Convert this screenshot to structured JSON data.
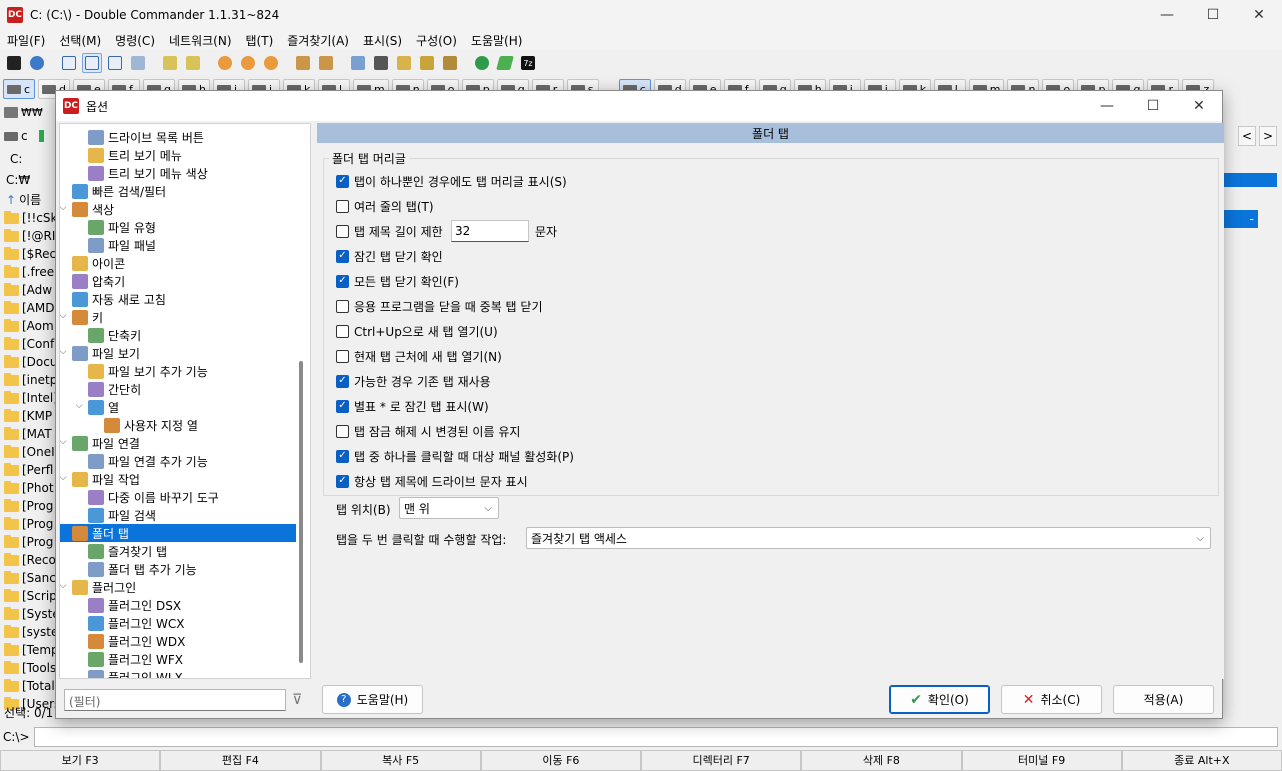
{
  "window": {
    "title": "C: (C:\\) - Double Commander 1.1.31~824",
    "minimize": "—",
    "maximize": "☐",
    "close": "✕"
  },
  "menu": [
    "파일(F)",
    "선택(M)",
    "명령(C)",
    "네트워크(N)",
    "탭(T)",
    "즐겨찾기(A)",
    "표시(S)",
    "구성(O)",
    "도움말(H)"
  ],
  "drives_left": [
    "c",
    "d",
    "e",
    "f",
    "g",
    "h",
    "i",
    "j",
    "k",
    "l",
    "m",
    "n",
    "o",
    "p",
    "q",
    "r",
    "s"
  ],
  "drives_right": [
    "c",
    "d",
    "e",
    "f",
    "g",
    "h",
    "i",
    "j",
    "k",
    "l",
    "m",
    "n",
    "o",
    "p",
    "q",
    "r",
    "z"
  ],
  "left_panel": {
    "tab_label": "₩₩",
    "drive": "c",
    "path_drive": "C:",
    "path": "C:₩",
    "column_name": "이름",
    "files": [
      "[!!cSk",
      "[!@RI",
      "[$Rec",
      "[.free",
      "[Adw",
      "[AMD",
      "[Aom",
      "[Conf",
      "[Docu",
      "[inetp",
      "[Intel]",
      "[KMP",
      "[MAT",
      "[OneI",
      "[Perfl",
      "[Phot",
      "[Prog",
      "[Prog",
      "[Prog",
      "[Reco",
      "[Sanc",
      "[Scrip",
      "[Syste",
      "[syste",
      "[Temp",
      "[Tools",
      "[Total",
      "[Users"
    ],
    "status": "선택: 0/1"
  },
  "right_panel": {
    "nav_left": "<",
    "nav_right": ">",
    "item_dash": "-"
  },
  "command_line": {
    "prompt": "C:\\>"
  },
  "function_keys": [
    "보기 F3",
    "편집 F4",
    "복사 F5",
    "이동 F6",
    "디렉터리 F7",
    "삭제 F8",
    "터미널 F9",
    "종료 Alt+X"
  ],
  "dialog": {
    "title": "옵션",
    "tree": [
      {
        "label": "드라이브 목록 버튼",
        "level": 1
      },
      {
        "label": "트리 보기 메뉴",
        "level": 1
      },
      {
        "label": "트리 보기 메뉴 색상",
        "level": 1
      },
      {
        "label": "빠른 검색/필터",
        "level": 0
      },
      {
        "label": "색상",
        "level": 0,
        "expanded": true
      },
      {
        "label": "파일 유형",
        "level": 1
      },
      {
        "label": "파일 패널",
        "level": 1
      },
      {
        "label": "아이콘",
        "level": 0
      },
      {
        "label": "압축기",
        "level": 0
      },
      {
        "label": "자동 새로 고침",
        "level": 0
      },
      {
        "label": "키",
        "level": 0,
        "expanded": true
      },
      {
        "label": "단축키",
        "level": 1
      },
      {
        "label": "파일 보기",
        "level": 0,
        "expanded": true
      },
      {
        "label": "파일 보기 추가 기능",
        "level": 1
      },
      {
        "label": "간단히",
        "level": 1
      },
      {
        "label": "열",
        "level": 1,
        "expanded": true
      },
      {
        "label": "사용자 지정 열",
        "level": 2
      },
      {
        "label": "파일 연결",
        "level": 0,
        "expanded": true
      },
      {
        "label": "파일 연결 추가 기능",
        "level": 1
      },
      {
        "label": "파일 작업",
        "level": 0,
        "expanded": true
      },
      {
        "label": "다중 이름 바꾸기 도구",
        "level": 1
      },
      {
        "label": "파일 검색",
        "level": 1
      },
      {
        "label": "폴더 탭",
        "level": 0,
        "expanded": true,
        "selected": true
      },
      {
        "label": "즐겨찾기 탭",
        "level": 1
      },
      {
        "label": "폴더 탭 추가 기능",
        "level": 1
      },
      {
        "label": "플러그인",
        "level": 0,
        "expanded": true
      },
      {
        "label": "플러그인 DSX",
        "level": 1
      },
      {
        "label": "플러그인 WCX",
        "level": 1
      },
      {
        "label": "플러그인 WDX",
        "level": 1
      },
      {
        "label": "플러그인 WFX",
        "level": 1
      },
      {
        "label": "플러그인 WLX",
        "level": 1
      }
    ],
    "filter_placeholder": "(필터)",
    "page_title": "폴더 탭",
    "group_title": "폴더 탭 머리글",
    "options": [
      {
        "label": "탭이 하나뿐인 경우에도 탭 머리글 표시(S)",
        "checked": true
      },
      {
        "label": "여러 줄의 탭(T)",
        "checked": false
      },
      {
        "label": "탭 제목 길이 제한",
        "checked": false
      },
      {
        "label": "잠긴 탭 닫기 확인",
        "checked": true
      },
      {
        "label": "모든 탭 닫기 확인(F)",
        "checked": true
      },
      {
        "label": "응용 프로그램을 닫을 때 중복 탭 닫기",
        "checked": false
      },
      {
        "label": "Ctrl+Up으로 새 탭 열기(U)",
        "checked": false
      },
      {
        "label": "현재 탭 근처에 새 탭 열기(N)",
        "checked": false
      },
      {
        "label": "가능한 경우 기존 탭 재사용",
        "checked": true
      },
      {
        "label": "별표 * 로 잠긴 탭 표시(W)",
        "checked": true
      },
      {
        "label": "탭 잠금 해제 시 변경된 이름 유지",
        "checked": false
      },
      {
        "label": "탭 중 하나를 클릭할 때 대상 패널 활성화(P)",
        "checked": true
      },
      {
        "label": "항상 탭 제목에 드라이브 문자 표시",
        "checked": true
      }
    ],
    "tab_title_length": "32",
    "tab_title_unit": "문자",
    "tab_position_label": "탭 위치(B)",
    "tab_position_value": "맨 위",
    "double_click_label": "탭을 두 번 클릭할 때 수행할 작업:",
    "double_click_value": "즐겨찾기 탭 액세스",
    "buttons": {
      "help": "도움말(H)",
      "ok": "확인(O)",
      "cancel": "취소(C)",
      "apply": "적용(A)"
    }
  },
  "colors": {
    "accent": "#0a74da",
    "page_header": "#a8bfdc"
  }
}
